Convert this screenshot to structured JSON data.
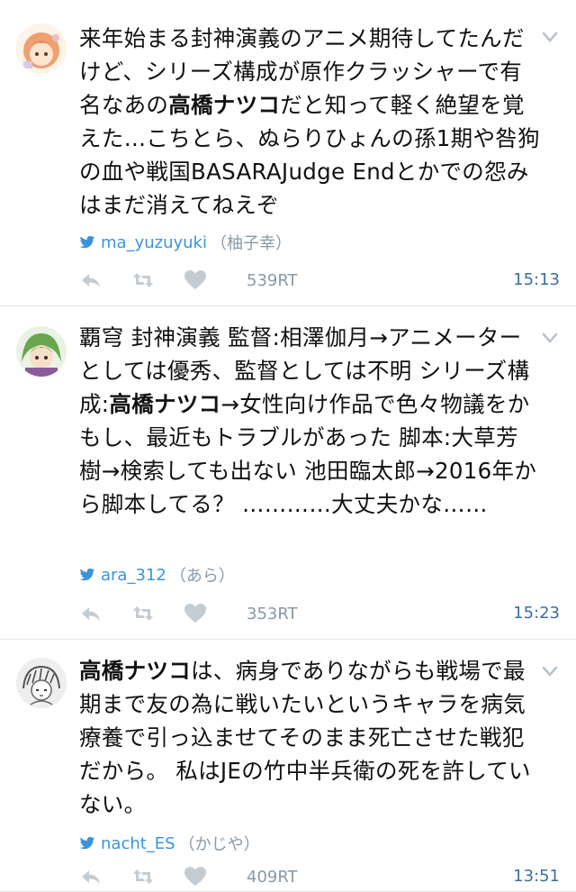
{
  "colors": {
    "link": "#3b94d9",
    "muted": "#8899a6",
    "time": "#3b6fa0",
    "divider": "#e1e8ed"
  },
  "tweets": [
    {
      "avatar_icon": "avatar-girl-orange-hair-icon",
      "segments": [
        {
          "text": "来年始まる封神演義のアニメ期待してたんだけど、シリーズ構成が原作クラッシャーで有名なあの",
          "bold": false
        },
        {
          "text": "高橋ナツコ",
          "bold": true
        },
        {
          "text": "だと知って軽く絶望を覚えた…こちとら、ぬらりひょんの孫1期や咎狗の血や戦国BASARAJudge Endとかでの怨みはまだ消えてねえぞ",
          "bold": false
        }
      ],
      "username": "ma_yuzuyuki",
      "display_name": "（柚子幸）",
      "retweets": "539RT",
      "time": "15:13"
    },
    {
      "avatar_icon": "avatar-green-hair-icon",
      "segments": [
        {
          "text": "覇穹 封神演義 監督:相澤伽月→アニメーターとしては優秀、監督としては不明 シリーズ構成:",
          "bold": false
        },
        {
          "text": "高橋ナツコ",
          "bold": true
        },
        {
          "text": "→女性向け作品で色々物議をかもし、最近もトラブルがあった 脚本:大草芳樹→検索しても出ない 池田臨太郎→2016年から脚本してる？ …………大丈夫かな……",
          "bold": false
        }
      ],
      "username": "ara_312",
      "display_name": "（あら）",
      "retweets": "353RT",
      "time": "15:23"
    },
    {
      "avatar_icon": "avatar-sketch-character-icon",
      "segments": [
        {
          "text": "高橋ナツコ",
          "bold": true
        },
        {
          "text": "は、病身でありながらも戦場で最期まで友の為に戦いたいというキャラを病気療養で引っ込ませてそのまま死亡させた戦犯だから。 私はJEの竹中半兵衛の死を許していない。",
          "bold": false
        }
      ],
      "username": "nacht_ES",
      "display_name": "（かじや）",
      "retweets": "409RT",
      "time": "13:51"
    }
  ]
}
